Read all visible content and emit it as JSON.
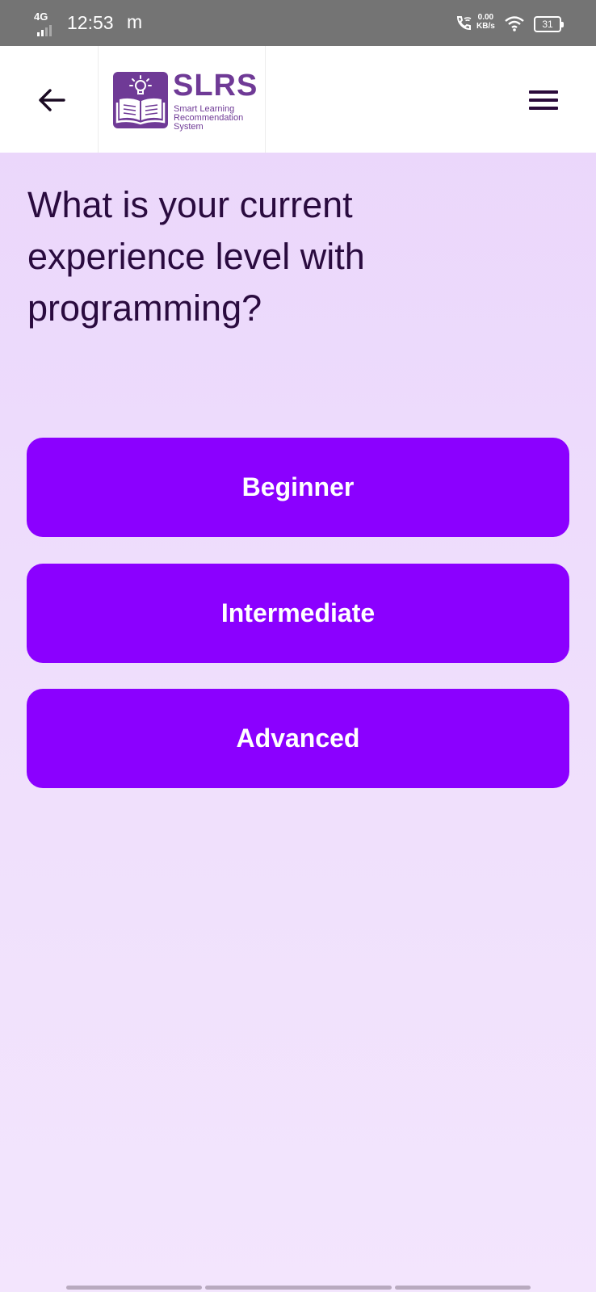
{
  "status_bar": {
    "network": "4G",
    "time": "12:53",
    "app_indicator": "m",
    "data_speed_value": "0.00",
    "data_speed_unit": "KB/s",
    "battery": "31",
    "icons": [
      "signal-icon",
      "wifi-call-icon",
      "wifi-icon",
      "battery-icon"
    ]
  },
  "header": {
    "back_icon": "arrow-left-icon",
    "logo": {
      "title": "SLRS",
      "subtitle_line1": "Smart Learning",
      "subtitle_line2": "Recommendation",
      "subtitle_line3": "System",
      "icon": "book-lightbulb-icon"
    },
    "menu_icon": "hamburger-menu-icon"
  },
  "question": {
    "text": "What is your current experience level with programming?"
  },
  "answers": [
    {
      "label": "Beginner"
    },
    {
      "label": "Intermediate"
    },
    {
      "label": "Advanced"
    }
  ],
  "colors": {
    "accent": "#8b00ff",
    "brand": "#6f3a96",
    "background": "#ead5fb",
    "status_bar": "#747474",
    "text_dark": "#2a0b3f"
  }
}
